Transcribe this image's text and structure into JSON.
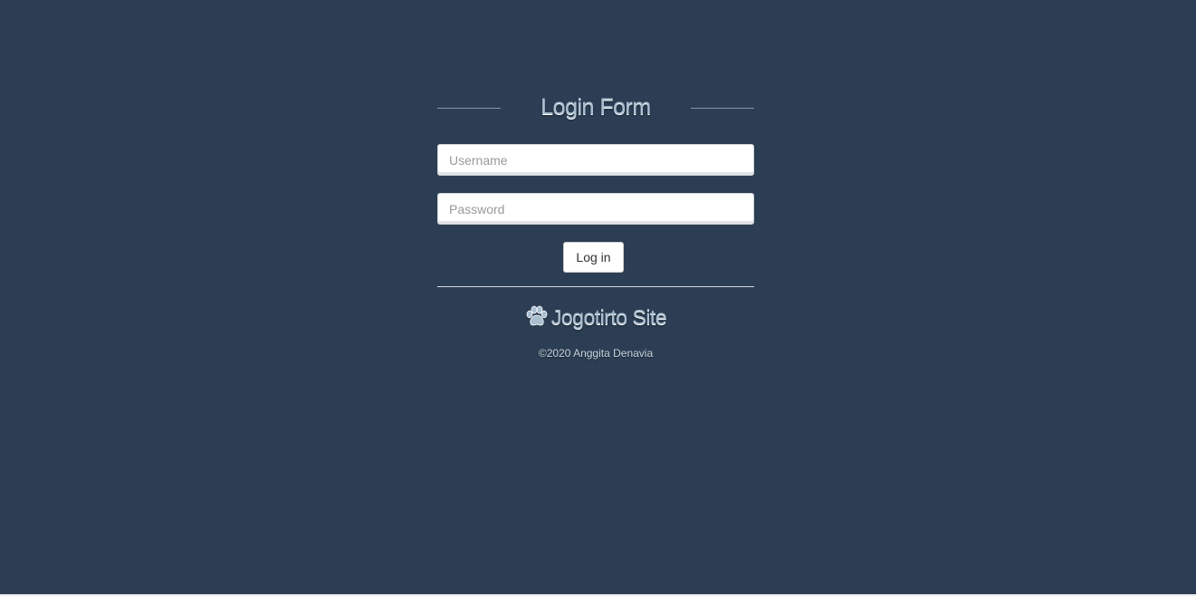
{
  "form": {
    "title": "Login Form",
    "username_placeholder": "Username",
    "password_placeholder": "Password",
    "submit_label": "Log in"
  },
  "footer": {
    "icon": "paw-icon",
    "site_name": "Jogotirto Site",
    "copyright": "©2020 Anggita Denavia"
  },
  "colors": {
    "background": "#2c3e53",
    "title_text": "#a9bfd0"
  }
}
